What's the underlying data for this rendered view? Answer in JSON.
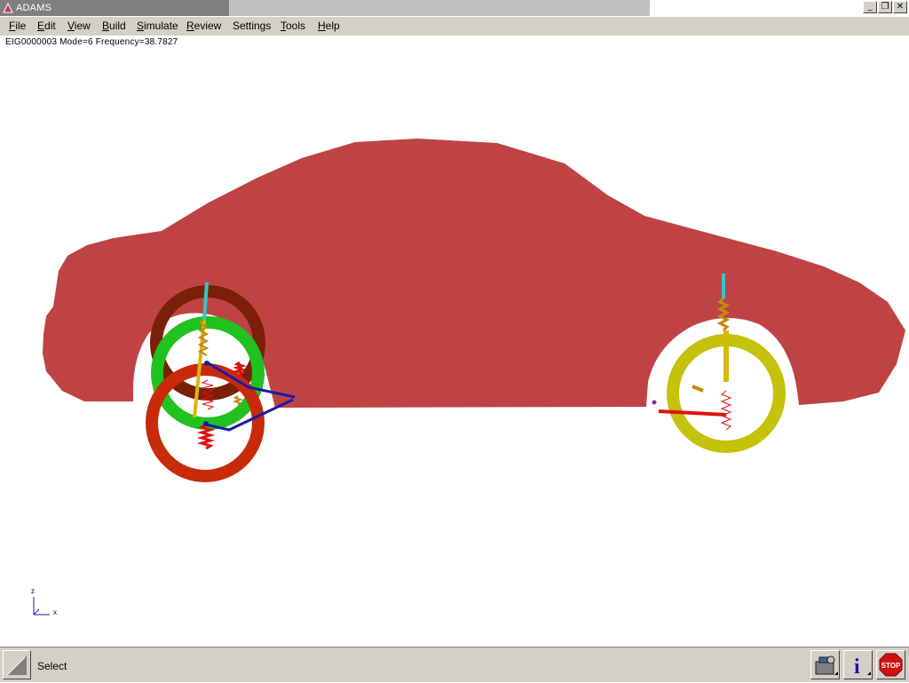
{
  "window": {
    "title": "ADAMS",
    "controls": {
      "minimize": "_",
      "restore": "❐",
      "close": "✕"
    }
  },
  "menu": [
    {
      "label": "File",
      "accel": "F",
      "rest": "ile"
    },
    {
      "label": "Edit",
      "accel": "E",
      "rest": "dit"
    },
    {
      "label": "View",
      "accel": "V",
      "rest": "iew"
    },
    {
      "label": "Build",
      "accel": "B",
      "rest": "uild"
    },
    {
      "label": "Simulate",
      "accel": "S",
      "rest": "imulate"
    },
    {
      "label": "Review",
      "accel": "R",
      "rest": "eview"
    },
    {
      "label": "Settings",
      "accel": "",
      "rest": "Settings"
    },
    {
      "label": "Tools",
      "accel": "T",
      "rest": "ools"
    },
    {
      "label": "Help",
      "accel": "H",
      "rest": "elp"
    }
  ],
  "info": {
    "text": "EIG0000003  Mode=6  Frequency=38.7827"
  },
  "triad": {
    "z_label": "z",
    "x_label": "x"
  },
  "status": {
    "text": "Select"
  },
  "toolbar_right": {
    "stop_label": "STOP",
    "info_label": "i"
  },
  "colors": {
    "body": "#c04343",
    "front_wheel_ring": "#c82a0a",
    "green_ring": "#1fc21f",
    "brown_ring": "#7a2006",
    "rear_wheel_ring": "#c4c20a",
    "link_blue": "#1a1aa8",
    "spring_red": "#e01010",
    "strut_yellow": "#d8b810",
    "strut_cyan": "#30c8c8",
    "ui_gray": "#d4d0c8"
  }
}
